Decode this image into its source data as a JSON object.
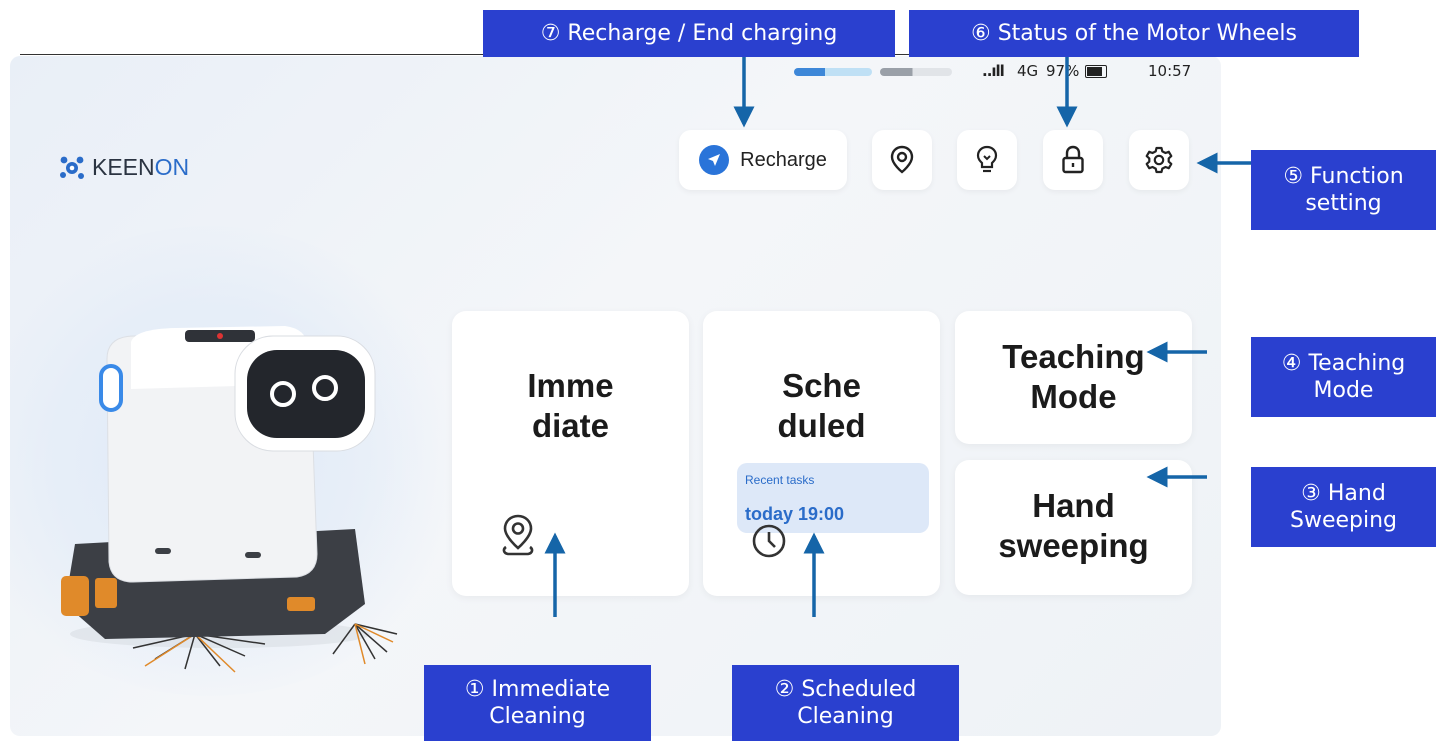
{
  "status_bar": {
    "signal": "..ıll",
    "network": "4G",
    "battery": "97%",
    "time": "10:57"
  },
  "brand": {
    "logo_part1": "KEEN",
    "logo_part2": "ON"
  },
  "toolbar": {
    "recharge_label": "Recharge",
    "icons": [
      "location-icon",
      "bulb-icon",
      "lock-icon",
      "gear-icon"
    ]
  },
  "cards": {
    "immediate": {
      "line1": "Imme",
      "line2": "diate"
    },
    "scheduled": {
      "line1": "Sche",
      "line2": "duled",
      "recent_label": "Recent tasks",
      "recent_value": "today 19:00"
    },
    "teaching": {
      "line1": "Teaching",
      "line2": "Mode"
    },
    "hand": {
      "line1": "Hand",
      "line2": "sweeping"
    }
  },
  "callouts": {
    "recharge": "⑦ Recharge / End charging",
    "motor_wheels": "⑥ Status of the Motor Wheels",
    "function_line1": "⑤ Function",
    "function_line2": "setting",
    "teaching_line1": "④ Teaching",
    "teaching_line2": "Mode",
    "hand_line1": "③ Hand",
    "hand_line2": "Sweeping",
    "immediate_line1": "① Immediate",
    "immediate_line2": "Cleaning",
    "scheduled_line1": "② Scheduled",
    "scheduled_line2": "Cleaning"
  },
  "colors": {
    "callout_bg": "#2a40cf",
    "arrow": "#1565a8",
    "accent_blue": "#2a74d9",
    "recent_bg": "#dde8f8"
  }
}
